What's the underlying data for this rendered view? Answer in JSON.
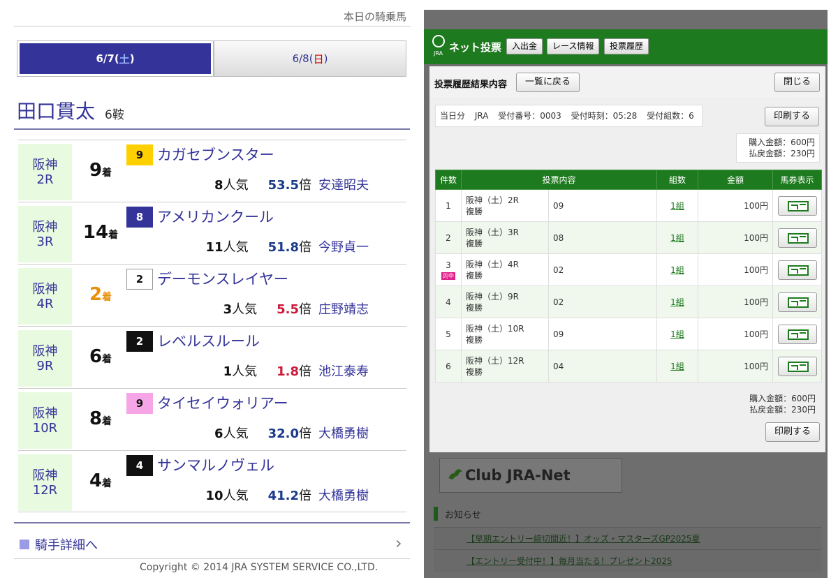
{
  "left": {
    "top_link": "本日の騎乗馬",
    "tabs": [
      {
        "date": "6/7",
        "day": "土",
        "open": "(",
        "close": ")"
      },
      {
        "date": "6/8",
        "day": "日",
        "open": "(",
        "close": ")"
      }
    ],
    "jockey": {
      "name": "田口貫太",
      "rides": "6鞍"
    },
    "rides": [
      {
        "venue": "阪神",
        "race": "2R",
        "finish": "9",
        "finish_suffix": "着",
        "horse_no": "9",
        "horse": "カガセブンスター",
        "pop": "8",
        "pop_suffix": "人気",
        "odds": "53.5",
        "odds_suffix": "倍",
        "trainer": "安達昭夫"
      },
      {
        "venue": "阪神",
        "race": "3R",
        "finish": "14",
        "finish_suffix": "着",
        "horse_no": "8",
        "horse": "アメリカンクール",
        "pop": "11",
        "pop_suffix": "人気",
        "odds": "51.8",
        "odds_suffix": "倍",
        "trainer": "今野貞一"
      },
      {
        "venue": "阪神",
        "race": "4R",
        "finish": "2",
        "finish_suffix": "着",
        "horse_no": "2",
        "horse": "デーモンスレイヤー",
        "pop": "3",
        "pop_suffix": "人気",
        "odds": "5.5",
        "odds_suffix": "倍",
        "trainer": "庄野靖志"
      },
      {
        "venue": "阪神",
        "race": "9R",
        "finish": "6",
        "finish_suffix": "着",
        "horse_no": "2",
        "horse": "レベルスルール",
        "pop": "1",
        "pop_suffix": "人気",
        "odds": "1.8",
        "odds_suffix": "倍",
        "trainer": "池江泰寿"
      },
      {
        "venue": "阪神",
        "race": "10R",
        "finish": "8",
        "finish_suffix": "着",
        "horse_no": "9",
        "horse": "タイセイウォリアー",
        "pop": "6",
        "pop_suffix": "人気",
        "odds": "32.0",
        "odds_suffix": "倍",
        "trainer": "大橋勇樹"
      },
      {
        "venue": "阪神",
        "race": "12R",
        "finish": "4",
        "finish_suffix": "着",
        "horse_no": "4",
        "horse": "サンマルノヴェル",
        "pop": "10",
        "pop_suffix": "人気",
        "odds": "41.2",
        "odds_suffix": "倍",
        "trainer": "大橋勇樹"
      }
    ],
    "detail_link": "騎手詳細へ",
    "detail_chevron": "›",
    "copyright": "Copyright © 2014 JRA SYSTEM SERVICE CO.,LTD."
  },
  "right": {
    "logo_small": "JRA",
    "brand": "ネット投票",
    "nav": [
      "入出金",
      "レース情報",
      "投票履歴"
    ],
    "modal": {
      "title": "投票履歴結果内容",
      "back_button": "一覧に戻る",
      "close_button": "閉じる",
      "summary": {
        "day": "当日分",
        "org": "JRA",
        "receipt_no": "受付番号：0003",
        "receipt_time": "受付時刻：05:28",
        "sets": "受付組数：6"
      },
      "print_button": "印刷する",
      "purchase": "購入金額：600円",
      "refund": "払戻金額：230円",
      "columns": [
        "件数",
        "投票内容",
        "組数",
        "金額",
        "馬券表示"
      ],
      "rows": [
        {
          "n": "1",
          "race": "阪神（土）2R",
          "type": "複勝",
          "selection": "09",
          "kumi": "1組",
          "amount": "100円",
          "hit": ""
        },
        {
          "n": "2",
          "race": "阪神（土）3R",
          "type": "複勝",
          "selection": "08",
          "kumi": "1組",
          "amount": "100円",
          "hit": ""
        },
        {
          "n": "3",
          "race": "阪神（土）4R",
          "type": "複勝",
          "selection": "02",
          "kumi": "1組",
          "amount": "100円",
          "hit": "的中"
        },
        {
          "n": "4",
          "race": "阪神（土）9R",
          "type": "複勝",
          "selection": "02",
          "kumi": "1組",
          "amount": "100円",
          "hit": ""
        },
        {
          "n": "5",
          "race": "阪神（土）10R",
          "type": "複勝",
          "selection": "09",
          "kumi": "1組",
          "amount": "100円",
          "hit": ""
        },
        {
          "n": "6",
          "race": "阪神（土）12R",
          "type": "複勝",
          "selection": "04",
          "kumi": "1組",
          "amount": "100円",
          "hit": ""
        }
      ]
    },
    "banner": "Club JRA-Net",
    "news_title": "お知らせ",
    "news": [
      "【早期エントリー締切間近！】オッズ・マスターズGP2025夏",
      "【エントリー受付中！】毎月当たる！プレゼント2025"
    ]
  },
  "colors": {
    "jra_green": "#1e7a1e",
    "jockey_blue": "#333399",
    "race_cell_bg": "#e8fae0",
    "gold": "#e8900c",
    "horse_no_colors": [
      "#ffd000",
      "#333399",
      "#ffffff",
      "#111111",
      "#f6a6e6",
      "#111111"
    ]
  }
}
